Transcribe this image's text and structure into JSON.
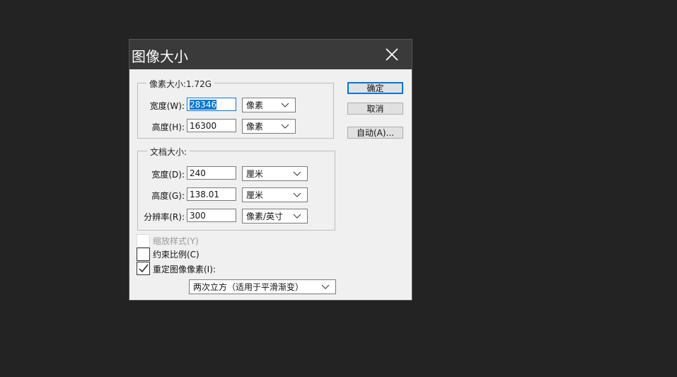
{
  "dialog": {
    "title": "图像大小",
    "close_icon": "close-icon"
  },
  "pixel_group": {
    "legend": "像素大小:1.72G",
    "width": {
      "label": "宽度(W):",
      "value": "28346",
      "unit": "像素"
    },
    "height": {
      "label": "高度(H):",
      "value": "16300",
      "unit": "像素"
    }
  },
  "doc_group": {
    "legend": "文档大小:",
    "width": {
      "label": "宽度(D):",
      "value": "240",
      "unit": "厘米"
    },
    "height": {
      "label": "高度(G):",
      "value": "138.01",
      "unit": "厘米"
    },
    "resolution": {
      "label": "分辨率(R):",
      "value": "300",
      "unit": "像素/英寸"
    }
  },
  "checkboxes": [
    {
      "label": "缩放样式(Y)",
      "checked": false,
      "disabled": true
    },
    {
      "label": "约束比例(C)",
      "checked": false,
      "disabled": false
    },
    {
      "label": "重定图像像素(I):",
      "checked": true,
      "disabled": false
    }
  ],
  "resample": {
    "value": "两次立方（适用于平滑渐变）"
  },
  "buttons": {
    "ok": "确定",
    "cancel": "取消",
    "auto": "自动(A)..."
  }
}
